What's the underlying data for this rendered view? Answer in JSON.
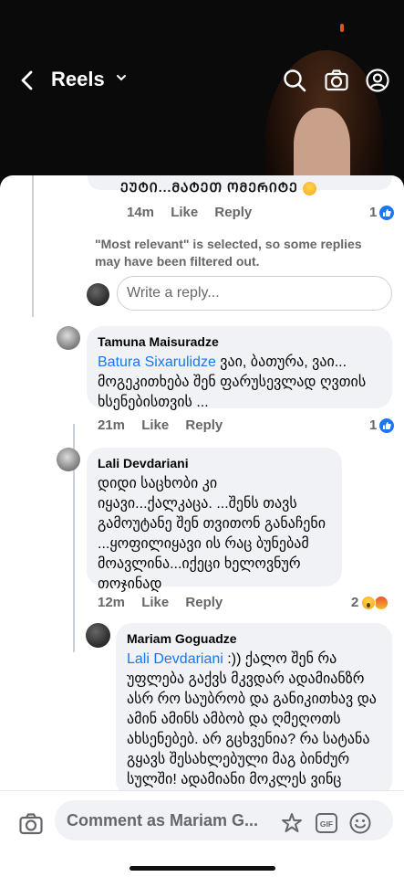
{
  "header": {
    "title": "Reels",
    "back_icon": "back-arrow-icon",
    "search_icon": "search-icon",
    "camera_icon": "camera-icon",
    "profile_icon": "profile-icon"
  },
  "top_comment": {
    "partial_text": "ᲔᲣᲢᲘ...ᲛᲐᲢᲔᲗ ᲝᲛᲔᲠᲘᲢᲔ",
    "time": "14m",
    "like": "Like",
    "reply": "Reply",
    "reaction_count": "1"
  },
  "notice": "\"Most relevant\" is selected, so some replies may have been filtered out.",
  "reply_input": {
    "placeholder": "Write a reply..."
  },
  "comments": [
    {
      "author": "Tamuna Maisuradze",
      "mention": "Batura Sixarulidze",
      "text": " ვაი, ბათურა, ვაი... მოგეკითხება შენ ფარუსევლად ღვთის ხსენებისთვის ...",
      "time": "21m",
      "like": "Like",
      "reply": "Reply",
      "reaction_count": "1"
    },
    {
      "author": "Lali Devdariani",
      "mention": "",
      "text": "დიდი საცხობი კი იყავი...ქალკაცა.  ...შენს თავს გამოუტანე შენ თვითონ განაჩენი ...ყოფილიყავი ის რაც ბუნებამ მოავლინა...იქეცი ხელოვნურ თოჯინად",
      "time": "12m",
      "like": "Like",
      "reply": "Reply",
      "reaction_count": "2"
    },
    {
      "author": "Mariam Goguadze",
      "mention": "Lali Devdariani",
      "text": " :)) ქალო შენ რა უფლება გაქვს მკვდარ ადამიანზრ ასრ რო საუბრობ და განიკითხავ და ამინ ამინს ამბობ და ღმეღოთს ახსენებებ. არ გცხვენია? რა სატანა გყავს შესახლებული მაგ ბინძურ სულში! ადამიანი მოკლეს ვინც"
    }
  ],
  "composer": {
    "placeholder": "Comment as Mariam G...",
    "camera_icon": "camera-icon",
    "sticker_icon": "sticker-icon",
    "gif_label": "GIF",
    "emoji_icon": "emoji-icon"
  },
  "colors": {
    "link": "#1877f2",
    "bubble": "#f0f2f5",
    "meta": "#65676b"
  }
}
